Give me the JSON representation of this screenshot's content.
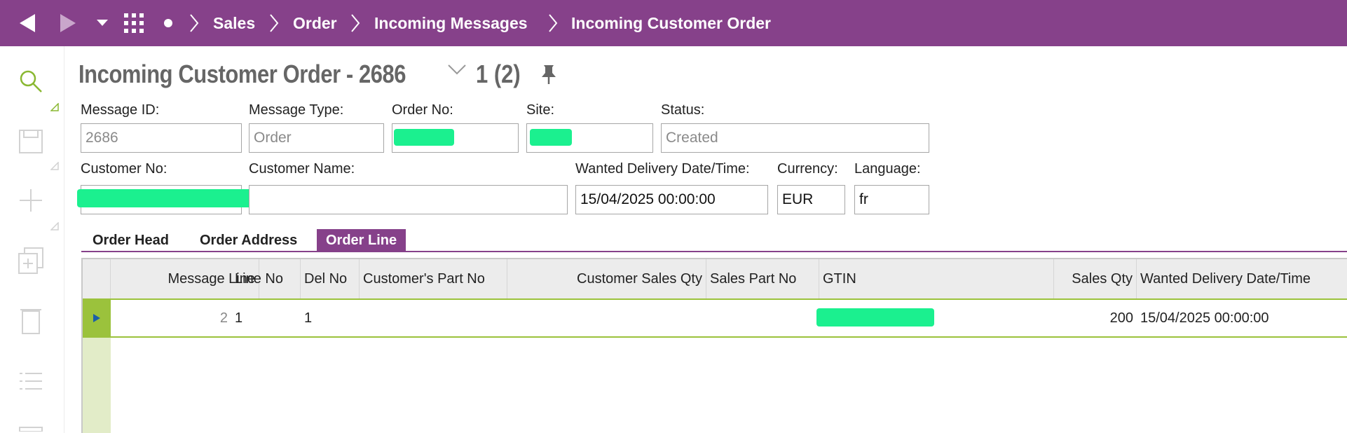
{
  "nav": {
    "back_icon": "back-arrow-icon",
    "forward_icon": "forward-arrow-icon",
    "dropdown_icon": "dropdown-caret-icon",
    "apps_icon": "app-grid-icon",
    "home_icon": "dot-icon",
    "breadcrumbs": [
      "Sales",
      "Order",
      "Incoming Messages",
      "Incoming Customer Order"
    ]
  },
  "sidebar": {
    "items": [
      "search-icon",
      "save-icon",
      "add-icon",
      "duplicate-icon",
      "delete-icon",
      "list-icon"
    ]
  },
  "header": {
    "title": "Incoming Customer Order - 2686",
    "record_position": "1 (2)"
  },
  "form": {
    "message_id": {
      "label": "Message ID:",
      "value": "2686"
    },
    "message_type": {
      "label": "Message Type:",
      "value": "Order"
    },
    "order_no": {
      "label": "Order No:",
      "value": ""
    },
    "site": {
      "label": "Site:",
      "value": ""
    },
    "status": {
      "label": "Status:",
      "value": "Created"
    },
    "customer_no": {
      "label": "Customer No:",
      "value": ""
    },
    "customer_name": {
      "label": "Customer Name:",
      "value": ""
    },
    "wanted_delivery": {
      "label": "Wanted Delivery Date/Time:",
      "value": "15/04/2025 00:00:00"
    },
    "currency": {
      "label": "Currency:",
      "value": "EUR"
    },
    "language": {
      "label": "Language:",
      "value": "fr"
    }
  },
  "tabs": [
    {
      "label": "Order Head",
      "active": false
    },
    {
      "label": "Order Address",
      "active": false
    },
    {
      "label": "Order Line",
      "active": true
    }
  ],
  "grid": {
    "columns": [
      "Message Line",
      "Line No",
      "Del No",
      "Customer's Part No",
      "Customer Sales Qty",
      "Sales Part No",
      "GTIN",
      "Sales Qty",
      "Wanted Delivery Date/Time"
    ],
    "rows": [
      {
        "message_line": "2",
        "line_no": "1",
        "del_no": "1",
        "customer_part_no": "",
        "customer_sales_qty": "",
        "sales_part_no": "",
        "gtin": "",
        "sales_qty": "200",
        "wanted_delivery": "15/04/2025 00:00:00"
      }
    ]
  },
  "colors": {
    "brand": "#86418a",
    "accent_green": "#9bc23c",
    "redaction": "#1bf08f"
  }
}
